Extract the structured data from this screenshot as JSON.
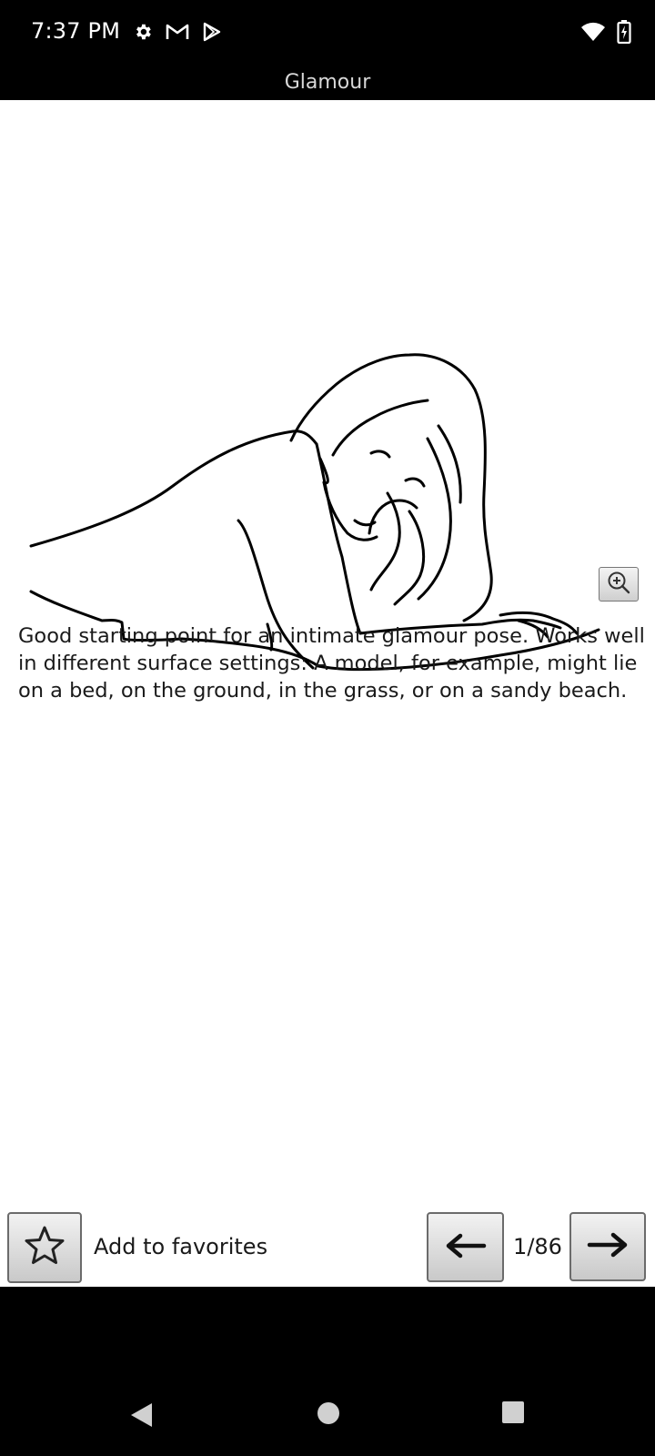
{
  "status_bar": {
    "time": "7:37 PM",
    "left_icons": [
      "settings-icon",
      "gmail-icon",
      "play-store-icon"
    ],
    "right_icons": [
      "wifi-icon",
      "battery-charging-icon"
    ]
  },
  "app": {
    "title": "Glamour"
  },
  "pose": {
    "description": "Good starting point for an intimate glamour pose. Works well in different surface settings: A model, for example, might lie on a bed, on the ground, in the grass, or on a sandy beach.",
    "current_page": 1,
    "total_pages": 86,
    "page_label": "1/86"
  },
  "controls": {
    "favorites_label": "Add to favorites",
    "icons": {
      "favorite": "star-icon",
      "previous": "arrow-left-icon",
      "next": "arrow-right-icon",
      "zoom": "zoom-in-icon"
    }
  },
  "nav_bar": {
    "icons": [
      "back-icon",
      "home-icon",
      "recents-icon"
    ]
  },
  "colors": {
    "status_bar_bg": "#000000",
    "content_bg": "#ffffff",
    "title_text": "#d8d8d8",
    "body_text": "#1a1a1a"
  }
}
